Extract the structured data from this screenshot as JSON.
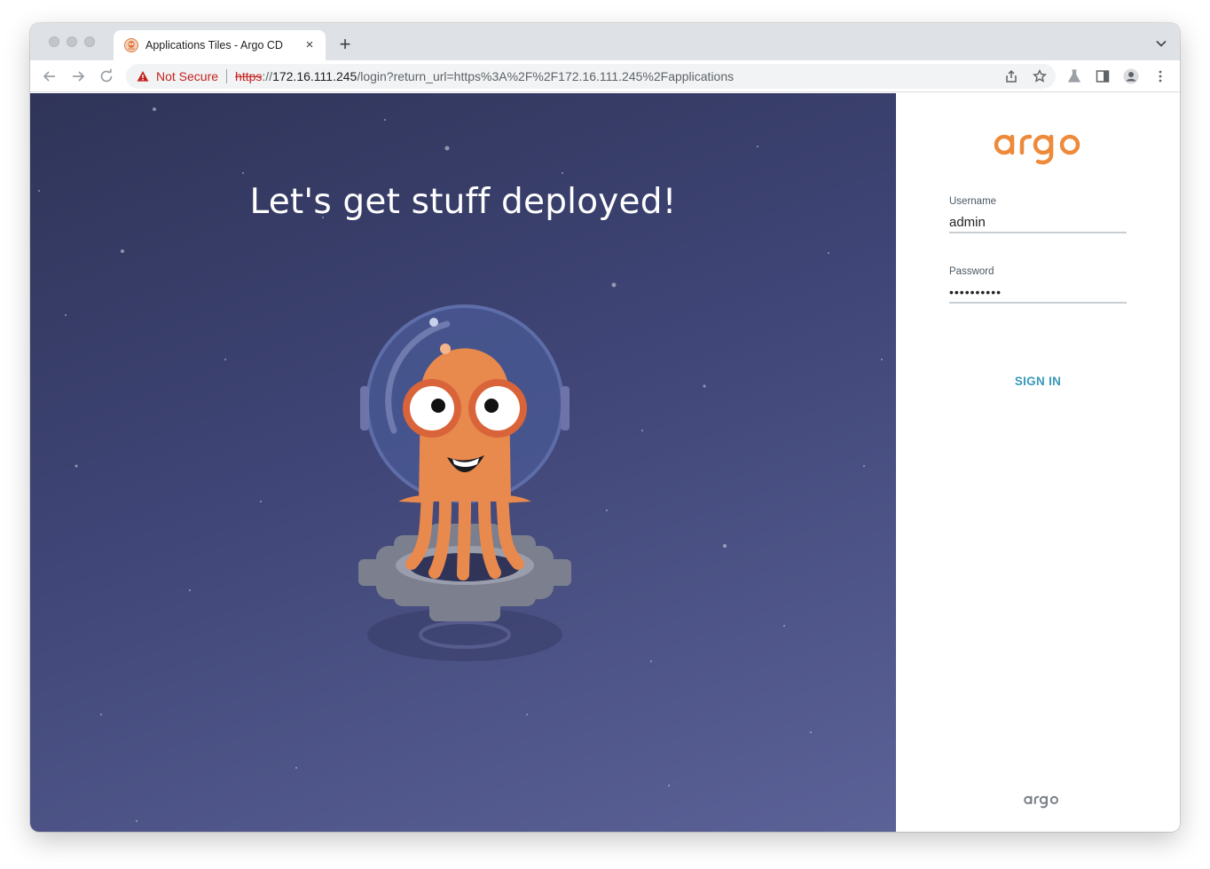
{
  "browser": {
    "tab_title": "Applications Tiles - Argo CD",
    "tab_close": "×",
    "new_tab": "+",
    "security_label": "Not Secure",
    "url_scheme": "https",
    "url_separator": "://",
    "url_host": "172.16.111.245",
    "url_path": "/login?return_url=https%3A%2F%2F172.16.111.245%2Fapplications"
  },
  "hero": {
    "heading": "Let's get stuff deployed!"
  },
  "login": {
    "username_label": "Username",
    "username_value": "admin",
    "password_label": "Password",
    "password_value": "••••••••••",
    "signin_label": "SIGN IN"
  },
  "colors": {
    "brand_orange": "#ee8a3b",
    "signin_blue": "#3a99ba",
    "hero_gradient_start": "#2f3458",
    "hero_gradient_end": "#5b6297",
    "not_secure_red": "#c5221f"
  },
  "icons": {
    "back": "arrow-left-icon",
    "forward": "arrow-right-icon",
    "reload": "reload-icon",
    "warning": "warning-triangle-icon",
    "share": "share-icon",
    "bookmark": "star-icon",
    "labs": "flask-icon",
    "sidepanel": "side-panel-icon",
    "profile": "profile-icon",
    "menu": "kebab-menu-icon"
  }
}
